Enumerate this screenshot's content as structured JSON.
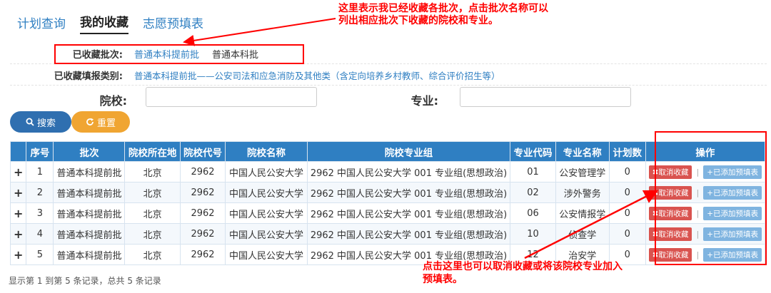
{
  "tabs": [
    "计划查询",
    "我的收藏",
    "志愿预填表"
  ],
  "annotations": {
    "top": "这里表示我已经收藏各批次，点击批次名称可以列出相应批次下收藏的院校和专业。",
    "bottom": "点击这里也可以取消收藏或将该院校专业加入预填表。"
  },
  "filters": {
    "batch_label": "已收藏批次:",
    "batch_options": [
      "普通本科提前批",
      "普通本科批"
    ],
    "category_label": "已收藏填报类别:",
    "category_value": "普通本科提前批——公安司法和应急消防及其他类（含定向培养乡村教师、综合评价招生等）",
    "school_label": "院校:",
    "school_value": "",
    "major_label": "专业:",
    "major_value": ""
  },
  "buttons": {
    "search": "搜索",
    "reset": "重置"
  },
  "table": {
    "headers": [
      "",
      "序号",
      "批次",
      "院校所在地",
      "院校代号",
      "院校名称",
      "院校专业组",
      "专业代码",
      "专业名称",
      "计划数",
      "操作"
    ],
    "rows": [
      {
        "no": "1",
        "batch": "普通本科提前批",
        "location": "北京",
        "code": "2962",
        "school": "中国人民公安大学",
        "group": "2962 中国人民公安大学 001 专业组(思想政治)",
        "major_code": "01",
        "major_name": "公安管理学",
        "plan": "0"
      },
      {
        "no": "2",
        "batch": "普通本科提前批",
        "location": "北京",
        "code": "2962",
        "school": "中国人民公安大学",
        "group": "2962 中国人民公安大学 001 专业组(思想政治)",
        "major_code": "02",
        "major_name": "涉外警务",
        "plan": "0"
      },
      {
        "no": "3",
        "batch": "普通本科提前批",
        "location": "北京",
        "code": "2962",
        "school": "中国人民公安大学",
        "group": "2962 中国人民公安大学 001 专业组(思想政治)",
        "major_code": "06",
        "major_name": "公安情报学",
        "plan": "0"
      },
      {
        "no": "4",
        "batch": "普通本科提前批",
        "location": "北京",
        "code": "2962",
        "school": "中国人民公安大学",
        "group": "2962 中国人民公安大学 001 专业组(思想政治)",
        "major_code": "10",
        "major_name": "侦查学",
        "plan": "0"
      },
      {
        "no": "5",
        "batch": "普通本科提前批",
        "location": "北京",
        "code": "2962",
        "school": "中国人民公安大学",
        "group": "2962 中国人民公安大学 001 专业组(思想政治)",
        "major_code": "12",
        "major_name": "治安学",
        "plan": "0"
      }
    ],
    "expand_symbol": "+",
    "op_cancel": "✖取消收藏",
    "op_separator": "|",
    "op_added": "+已添加预填表"
  },
  "footer": "显示第 1 到第 5 条记录，总共 5 条记录",
  "colors": {
    "accent": "#2f7fc2",
    "annotation": "#ff0000",
    "cancel": "#d9534f",
    "reset": "#f0a532"
  },
  "icons": {
    "search": "search-icon",
    "reset": "refresh-icon"
  }
}
